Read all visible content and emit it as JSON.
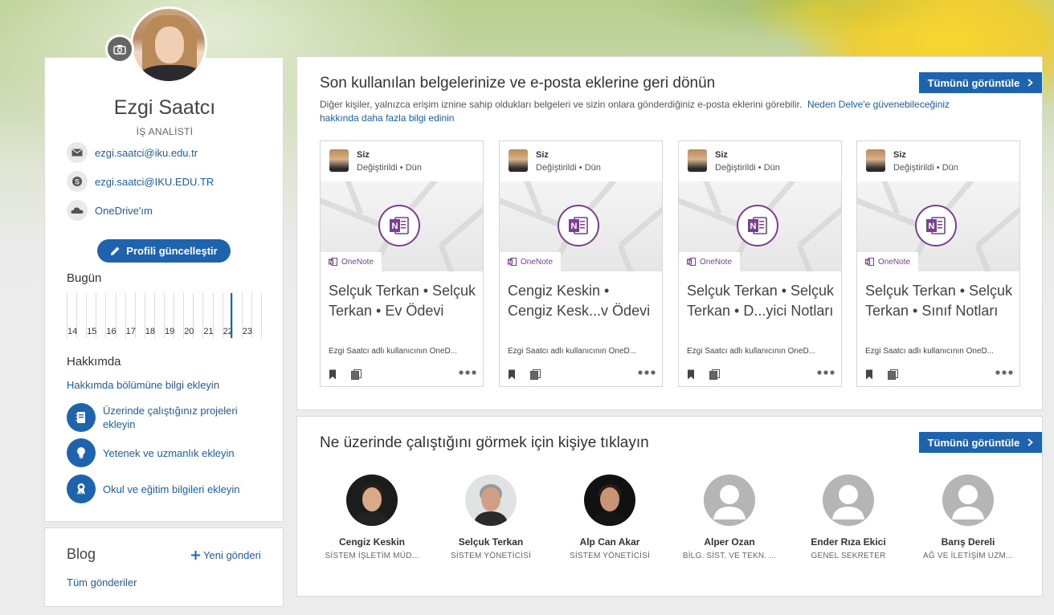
{
  "profile": {
    "name": "Ezgi Saatcı",
    "title": "İŞ ANALİSTİ",
    "email": "ezgi.saatci@iku.edu.tr",
    "skype": "ezgi.saatci@IKU.EDU.TR",
    "onedrive": "OneDrive'ım",
    "update_label": "Profili güncelleştir"
  },
  "today": {
    "heading": "Bugün",
    "hours": [
      "14",
      "15",
      "16",
      "17",
      "18",
      "19",
      "20",
      "21",
      "22",
      "23"
    ]
  },
  "about": {
    "heading": "Hakkımda",
    "add_link": "Hakkımda bölümüne bilgi ekleyin",
    "actions": [
      {
        "label": "Üzerinde çalıştığınız projeleri ekleyin",
        "icon": "notebook-icon"
      },
      {
        "label": "Yetenek ve uzmanlık ekleyin",
        "icon": "lightbulb-icon"
      },
      {
        "label": "Okul ve eğitim bilgileri ekleyin",
        "icon": "ribbon-icon"
      }
    ]
  },
  "blog": {
    "heading": "Blog",
    "new_post": "Yeni gönderi",
    "all_posts": "Tüm gönderiler"
  },
  "documents": {
    "heading": "Son kullanılan belgelerinize ve e-posta eklerine geri dönün",
    "see_all": "Tümünü görüntüle",
    "description": "Diğer kişiler, yalnızca erişim iznine sahip oldukları belgeleri ve sizin onlara gönderdiğiniz e-posta eklerini görebilir.",
    "trust_link": "Neden Delve'e güvenebileceğiniz hakkında daha fazla bilgi edinin",
    "cards": [
      {
        "owner": "Siz",
        "modified": "Değiştirildi • Dün",
        "app": "OneNote",
        "title": "Selçuk Terkan • Selçuk Terkan • Ev Ödevi",
        "path": "Ezgi Saatcı adlı kullanıcının OneD..."
      },
      {
        "owner": "Siz",
        "modified": "Değiştirildi • Dün",
        "app": "OneNote",
        "title": "Cengiz Keskin • Cengiz Kesk...v Ödevi",
        "path": "Ezgi Saatcı adlı kullanıcının OneD..."
      },
      {
        "owner": "Siz",
        "modified": "Değiştirildi • Dün",
        "app": "OneNote",
        "title": "Selçuk Terkan • Selçuk Terkan • D...yici Notları",
        "path": "Ezgi Saatcı adlı kullanıcının OneD..."
      },
      {
        "owner": "Siz",
        "modified": "Değiştirildi • Dün",
        "app": "OneNote",
        "title": "Selçuk Terkan • Selçuk Terkan • Sınıf Notları",
        "path": "Ezgi Saatcı adlı kullanıcının OneD..."
      }
    ]
  },
  "people": {
    "heading": "Ne üzerinde çalıştığını görmek için kişiye tıklayın",
    "see_all": "Tümünü görüntüle",
    "list": [
      {
        "name": "Cengiz Keskin",
        "role": "SİSTEM İŞLETİM MÜD...",
        "photo": true
      },
      {
        "name": "Selçuk Terkan",
        "role": "SİSTEM YÖNETİCİSİ",
        "photo": true
      },
      {
        "name": "Alp Can Akar",
        "role": "SİSTEM YÖNETİCİSİ",
        "photo": true
      },
      {
        "name": "Alper Ozan",
        "role": "BİLG. SİST. VE TEKN. ...",
        "photo": false
      },
      {
        "name": "Ender Rıza Ekici",
        "role": "GENEL SEKRETER",
        "photo": false
      },
      {
        "name": "Barış Dereli",
        "role": "AĞ VE İLETİŞİM UZM...",
        "photo": false
      }
    ]
  },
  "colors": {
    "accent": "#1e63ad",
    "onenote": "#7b3f8f"
  }
}
